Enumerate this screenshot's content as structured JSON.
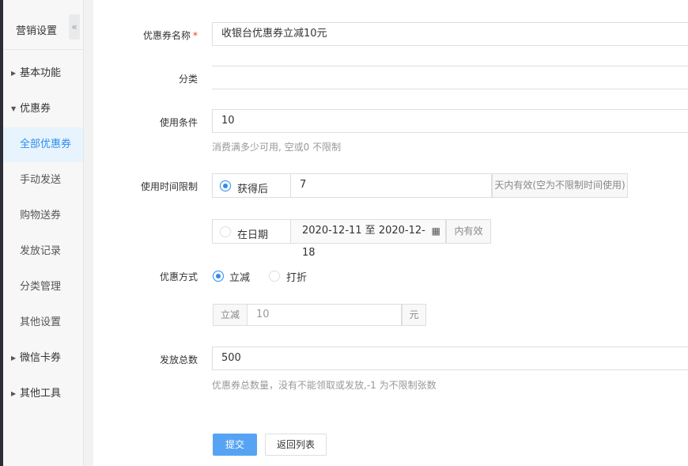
{
  "sidebar": {
    "title": "营销设置",
    "collapse_icon": "«",
    "groups": [
      {
        "label": "基本功能"
      },
      {
        "label": "优惠券"
      },
      {
        "label": "微信卡券"
      },
      {
        "label": "其他工具"
      }
    ],
    "sub_items": [
      {
        "label": "全部优惠券",
        "active": true
      },
      {
        "label": "手动发送"
      },
      {
        "label": "购物送券"
      },
      {
        "label": "发放记录"
      },
      {
        "label": "分类管理"
      },
      {
        "label": "其他设置"
      }
    ]
  },
  "form": {
    "name": {
      "label": "优惠券名称",
      "required": "*",
      "value": "收银台优惠券立减10元"
    },
    "category": {
      "label": "分类",
      "value": ""
    },
    "condition": {
      "label": "使用条件",
      "value": "10",
      "hint": "消费满多少可用, 空或0 不限制"
    },
    "time_limit": {
      "label": "使用时间限制",
      "option_after": "获得后",
      "days_value": "7",
      "days_suffix": "天内有效(空为不限制时间使用)",
      "option_date": "在日期",
      "date_range": "2020-12-11 至 2020-12-18",
      "date_suffix": "内有效",
      "selected": "获得后"
    },
    "discount_type": {
      "label": "优惠方式",
      "option_minus": "立减",
      "option_discount": "打折",
      "selected": "立减",
      "prefix": "立减",
      "placeholder": "10",
      "suffix": "元"
    },
    "total": {
      "label": "发放总数",
      "value": "500",
      "hint": "优惠券总数量，没有不能领取或发放,-1 为不限制张数"
    }
  },
  "buttons": {
    "submit": "提交",
    "back": "返回列表"
  },
  "colors": {
    "accent": "#2d8cf0",
    "required": "#ed4014"
  }
}
